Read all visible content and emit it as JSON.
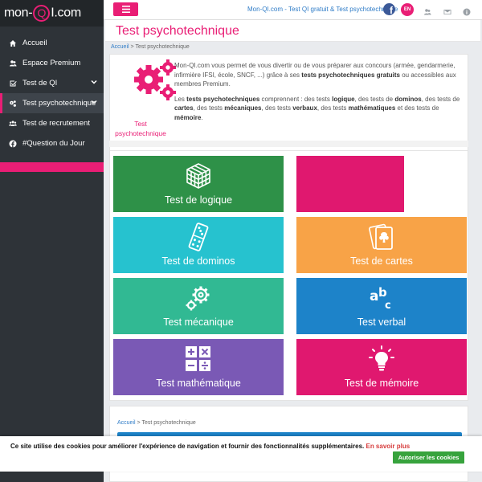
{
  "logo": {
    "prefix": "mon-",
    "q": "Q",
    "suffix": "I.com"
  },
  "sidebar": {
    "items": [
      {
        "label": "Accueil",
        "icon": "home-icon"
      },
      {
        "label": "Espace Premium",
        "icon": "users-icon"
      },
      {
        "label": "Test de QI",
        "icon": "checkbox-icon",
        "expandable": true
      },
      {
        "label": "Test psychotechnique",
        "icon": "gears-icon",
        "expandable": true,
        "active": true
      },
      {
        "label": "Test de recrutement",
        "icon": "group-icon"
      },
      {
        "label": "#Question du Jour",
        "icon": "facebook-icon"
      }
    ]
  },
  "topbar": {
    "link": "Mon-QI.com - Test QI gratuit & Test psychotechnique",
    "lang": "EN",
    "icons": [
      "facebook-icon",
      "users-icon",
      "mail-icon",
      "info-icon"
    ]
  },
  "page": {
    "title": "Test psychotechnique",
    "breadcrumb_home": "Accueil",
    "breadcrumb_sep": " > ",
    "breadcrumb_current": "Test psychotechnique"
  },
  "intro": {
    "label": "Test psychotechnique",
    "p1_a": "Mon-QI.com vous permet de vous divertir ou de vous préparer aux concours (armée, gendarmerie, infirmière IFSI, école, SNCF, ...) grâce à ses ",
    "p1_b": "tests psychotechniques gratuits",
    "p1_c": " ou accessibles aux membres Premium.",
    "p2_a": "Les ",
    "p2_b": "tests psychotechniques",
    "p2_c": " comprennent : des tests ",
    "p2_d": "logique",
    "p2_e": ", des tests de ",
    "p2_f": "dominos",
    "p2_g": ", des tests de ",
    "p2_h": "cartes",
    "p2_i": ", des tests ",
    "p2_j": "mécaniques",
    "p2_k": ", des tests ",
    "p2_l": "verbaux",
    "p2_m": ", des tests ",
    "p2_n": "mathématiques",
    "p2_o": " et des tests de ",
    "p2_p": "mémoire",
    "p2_q": "."
  },
  "tiles": [
    {
      "label": "Test de logique",
      "color": "#2e9148",
      "icon": "cube-icon"
    },
    {
      "label": "",
      "color": "#e0186f",
      "icon": ""
    },
    {
      "label": "Test de dominos",
      "color": "#26c2cf",
      "icon": "domino-icon"
    },
    {
      "label": "Test de cartes",
      "color": "#f8a347",
      "icon": "cards-icon"
    },
    {
      "label": "Test mécanique",
      "color": "#31b993",
      "icon": "gears-icon"
    },
    {
      "label": "Test verbal",
      "color": "#1d83c9",
      "icon": "abc-icon"
    },
    {
      "label": "Test mathématique",
      "color": "#7a59b5",
      "icon": "calculator-icon"
    },
    {
      "label": "Test de mémoire",
      "color": "#e0186f",
      "icon": "lightbulb-icon"
    }
  ],
  "cookie": {
    "text": "Ce site utilise des cookies pour améliorer l'expérience de navigation et fournir des fonctionnalités supplémentaires. ",
    "link": "En savoir plus",
    "button": "Autoriser les cookies"
  }
}
